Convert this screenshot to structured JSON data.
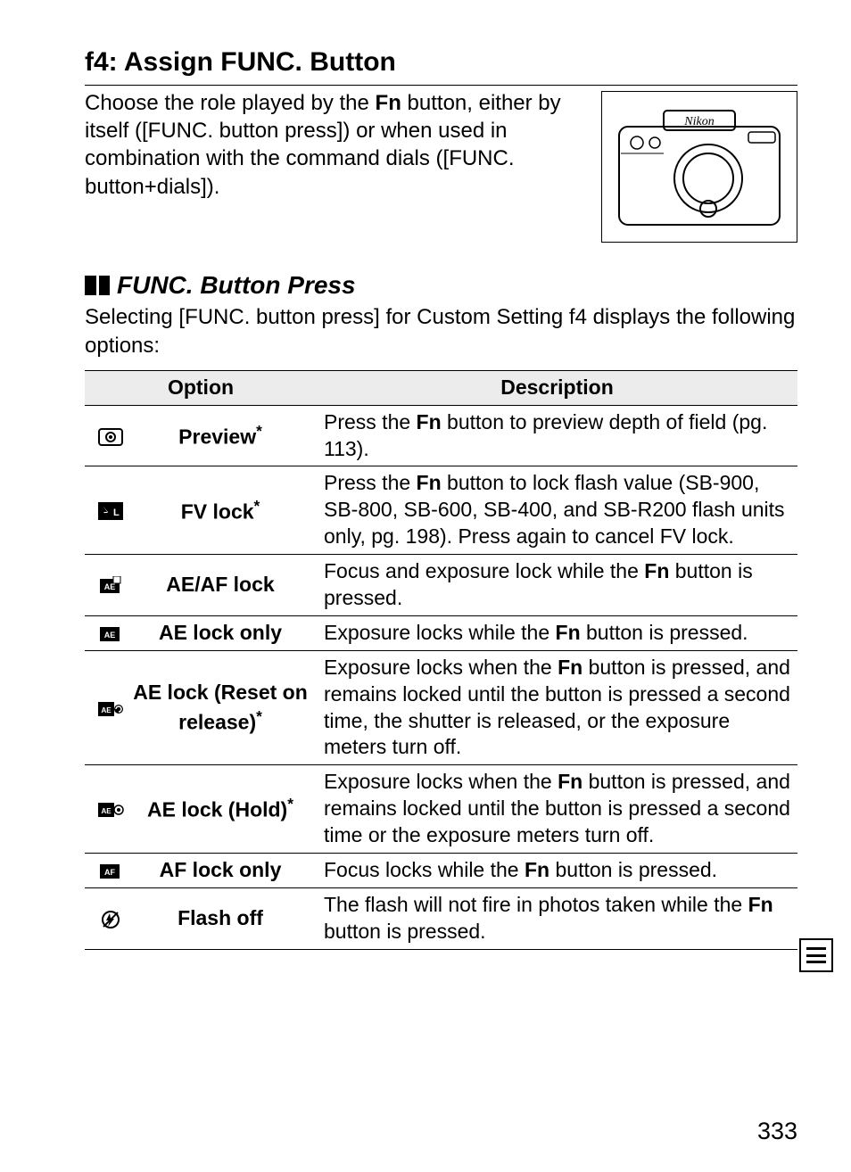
{
  "heading": "f4: Assign FUNC. Button",
  "intro": {
    "pre": "Choose the role played by the ",
    "fn": "Fn",
    "post": " button, either by itself ([FUNC. button press]) or when used in combination with the command dials ([FUNC. button+dials])."
  },
  "camera_brand": "Nikon",
  "subhead": "FUNC. Button Press",
  "subhead_desc": "Selecting [FUNC. button press] for Custom Setting f4 displays the following options:",
  "col_option": "Option",
  "col_description": "Description",
  "rows": [
    {
      "icon": "preview",
      "option": "Preview",
      "option_ast": "*",
      "desc_pre": "Press the ",
      "fn": "Fn",
      "desc_post": " button to preview depth of field (pg. 113)."
    },
    {
      "icon": "fvlock",
      "option": "FV lock",
      "option_ast": "*",
      "desc_pre": "Press the ",
      "fn": "Fn",
      "desc_post": " button to lock flash value (SB-900, SB-800, SB-600, SB-400, and SB-R200 flash units only, pg. 198).  Press again to cancel FV lock."
    },
    {
      "icon": "aeaf",
      "option": "AE/AF lock",
      "option_ast": "",
      "desc_pre": "Focus and exposure lock while the ",
      "fn": "Fn",
      "desc_post": " button is pressed."
    },
    {
      "icon": "ae",
      "option": "AE lock only",
      "option_ast": "",
      "desc_pre": "Exposure locks while the ",
      "fn": "Fn",
      "desc_post": " button is pressed."
    },
    {
      "icon": "aereset",
      "option": "AE lock (Reset on release)",
      "option_ast": "*",
      "desc_pre": "Exposure locks when the ",
      "fn": "Fn",
      "desc_post": " button is pressed, and remains locked until the button is pressed a second time, the shutter is released, or the exposure meters turn off."
    },
    {
      "icon": "aehold",
      "option": "AE lock (Hold)",
      "option_ast": "*",
      "desc_pre": "Exposure locks when the ",
      "fn": "Fn",
      "desc_post": " button is pressed, and remains locked until the button is pressed a second time or the exposure meters turn off."
    },
    {
      "icon": "af",
      "option": "AF lock only",
      "option_ast": "",
      "desc_pre": "Focus locks while the ",
      "fn": "Fn",
      "desc_post": " button is pressed."
    },
    {
      "icon": "flashoff",
      "option": "Flash off",
      "option_ast": "",
      "desc_pre": "The flash will not fire in photos taken while the ",
      "fn": "Fn",
      "desc_post": " button is pressed."
    }
  ],
  "page_number": "333"
}
